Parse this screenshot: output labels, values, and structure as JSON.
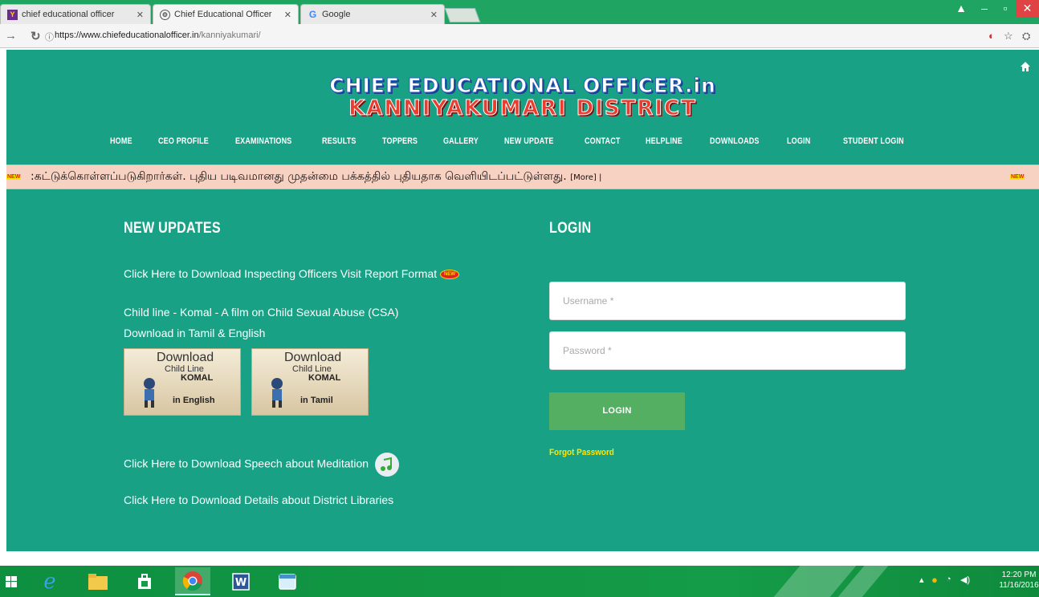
{
  "browser": {
    "tabs": [
      {
        "title": "chief educational officer",
        "favicon": "yahoo-icon",
        "active": false
      },
      {
        "title": "Chief Educational Officer",
        "favicon": "site-icon",
        "active": true
      },
      {
        "title": "Google",
        "favicon": "google-icon",
        "active": false
      }
    ],
    "url_host": "https://www.chiefeducationalofficer.in",
    "url_path": "/kanniyakumari/"
  },
  "site": {
    "title_line1": "CHIEF EDUCATIONAL OFFICER.in",
    "title_line2": "KANNIYAKUMARI DISTRICT",
    "nav": [
      "HOME",
      "CEO PROFILE",
      "EXAMINATIONS",
      "RESULTS",
      "TOPPERS",
      "GALLERY",
      "NEW UPDATE",
      "CONTACT",
      "HELPLINE",
      "DOWNLOADS",
      "LOGIN",
      "STUDENT LOGIN"
    ]
  },
  "ticker": {
    "badge": "NEW",
    "text": ":கட்டுக்கொள்ளப்படுகிறார்கள். புதிய படிவமானது முதன்மை பக்கத்தில் புதியதாக வெளியிடப்பட்டுள்ளது.",
    "more": "[More] |"
  },
  "updates": {
    "heading": "NEW UPDATES",
    "new_badge": "NEW",
    "items": [
      "Click Here to Download Inspecting Officers Visit Report Format",
      "Child line - Komal - A film on Child Sexual Abuse (CSA)",
      "Download in Tamil & English",
      "Click Here to Download Speech about Meditation",
      "Click Here to Download Details about District Libraries"
    ],
    "thumbnails": [
      {
        "line1": "Download",
        "line2": "Child Line",
        "line3": "KOMAL",
        "lang": "in English"
      },
      {
        "line1": "Download",
        "line2": "Child Line",
        "line3": "KOMAL",
        "lang": "in Tamil"
      }
    ]
  },
  "login": {
    "heading": "LOGIN",
    "username_placeholder": "Username *",
    "password_placeholder": "Password *",
    "button": "LOGIN",
    "forgot": "Forgot Password"
  },
  "taskbar": {
    "time": "12:20 PM",
    "date": "11/16/2016"
  },
  "colors": {
    "page_bg": "#18a185",
    "ticker_bg": "#f7d2c3",
    "login_button": "#55af63",
    "forgot_link": "#ffe600",
    "title_red": "#e93d30",
    "title_blue_outline": "#2d5ec0"
  }
}
